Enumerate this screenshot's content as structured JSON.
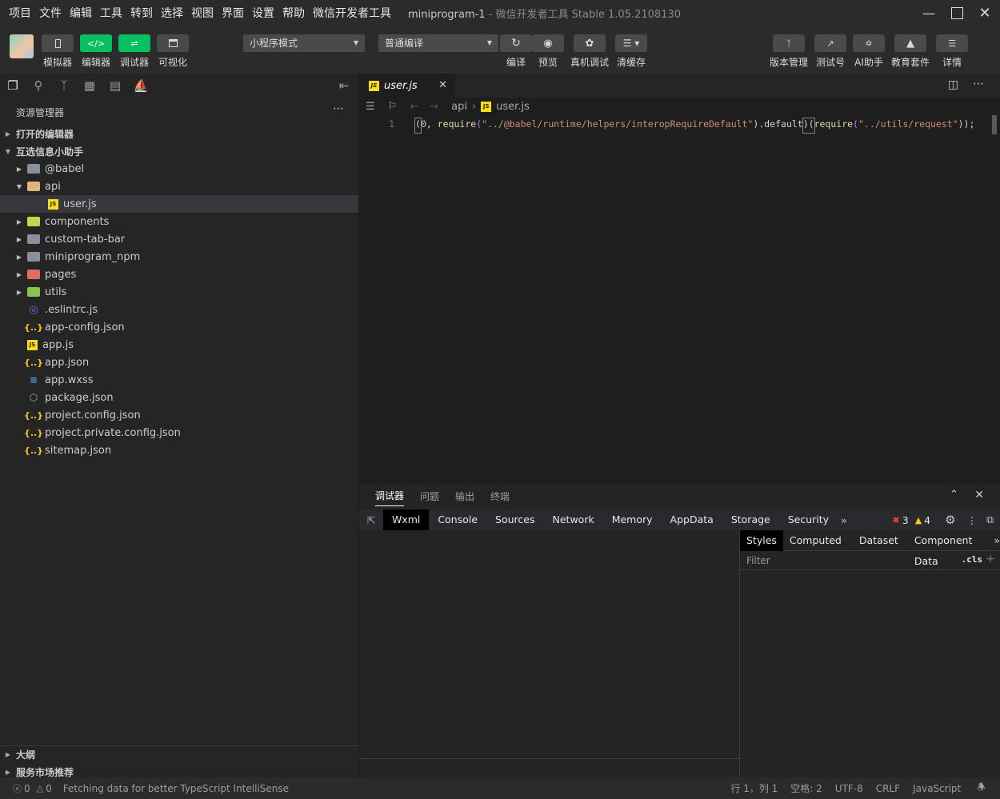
{
  "menu": {
    "items": [
      "项目",
      "文件",
      "编辑",
      "工具",
      "转到",
      "选择",
      "视图",
      "界面",
      "设置",
      "帮助",
      "微信开发者工具"
    ],
    "window_title": "miniprogram-1",
    "window_subtitle": " - 微信开发者工具 Stable 1.05.2108130"
  },
  "toolbar": {
    "simulator": "模拟器",
    "editor": "编辑器",
    "debugger": "调试器",
    "visualize": "可视化",
    "mode_select": "小程序模式",
    "compile_select": "普通编译",
    "compile": "编译",
    "preview": "预览",
    "remote_debug": "真机调试",
    "clear_cache": "清缓存",
    "version": "版本管理",
    "test_account": "测试号",
    "ai_helper": "AI助手",
    "edu_kit": "教育套件",
    "details": "详情"
  },
  "explorer": {
    "title": "资源管理器",
    "open_editors": "打开的编辑器",
    "project": "互选信息小助手",
    "tree": [
      {
        "name": "@babel",
        "type": "folder"
      },
      {
        "name": "api",
        "type": "folder-open"
      },
      {
        "name": "user.js",
        "type": "js"
      },
      {
        "name": "components",
        "type": "folder-comp"
      },
      {
        "name": "custom-tab-bar",
        "type": "folder"
      },
      {
        "name": "miniprogram_npm",
        "type": "folder"
      },
      {
        "name": "pages",
        "type": "folder-pages"
      },
      {
        "name": "utils",
        "type": "folder-utils"
      },
      {
        "name": ".eslintrc.js",
        "type": "eslint"
      },
      {
        "name": "app-config.json",
        "type": "json"
      },
      {
        "name": "app.js",
        "type": "js"
      },
      {
        "name": "app.json",
        "type": "json"
      },
      {
        "name": "app.wxss",
        "type": "css"
      },
      {
        "name": "package.json",
        "type": "pkg"
      },
      {
        "name": "project.config.json",
        "type": "json"
      },
      {
        "name": "project.private.config.json",
        "type": "json"
      },
      {
        "name": "sitemap.json",
        "type": "json"
      }
    ],
    "outline": "大纲",
    "market": "服务市场推荐"
  },
  "editor": {
    "tab_label": "user.js",
    "breadcrumb_folder": "api",
    "breadcrumb_file": "user.js",
    "line_number": "1",
    "code": {
      "p1": "(",
      "n0": "0",
      "p2": ", ",
      "f1": "require",
      "p3": "(",
      "s1": "\"../@babel/runtime/helpers/interopRequireDefault\"",
      "p4": ").default",
      "p5": ")(",
      "f2": "require",
      "p6": "(",
      "s2": "\"../utils/request\"",
      "p7": "));"
    }
  },
  "debugger": {
    "tabs": [
      "调试器",
      "问题",
      "输出",
      "终端"
    ],
    "devtools_tabs": [
      "Wxml",
      "Console",
      "Sources",
      "Network",
      "Memory",
      "AppData",
      "Storage",
      "Security"
    ],
    "error_count": "3",
    "warning_count": "4",
    "styles_tabs": [
      "Styles",
      "Computed",
      "Dataset",
      "Component Data"
    ],
    "filter_placeholder": "Filter",
    "cls": ".cls"
  },
  "status": {
    "errors": "0",
    "warnings": "0",
    "message": "Fetching data for better TypeScript IntelliSense",
    "position": "行 1，列 1",
    "spaces": "空格: 2",
    "encoding": "UTF-8",
    "eol": "CRLF",
    "language": "JavaScript"
  }
}
